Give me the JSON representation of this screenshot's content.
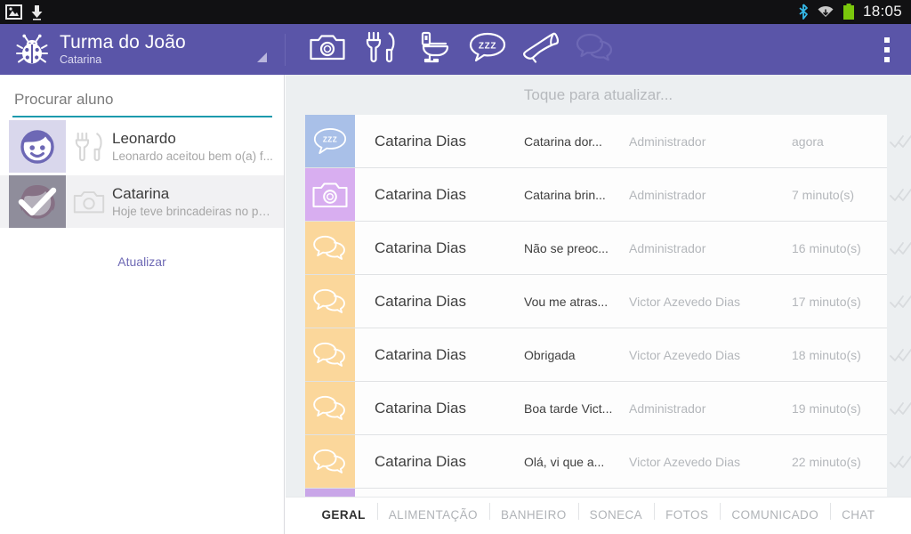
{
  "statusbar": {
    "time": "18:05",
    "icons": [
      "image-icon",
      "download-icon",
      "bluetooth-icon",
      "wifi-icon",
      "battery-icon"
    ],
    "battery_color": "#7ac70c"
  },
  "appbar": {
    "logo_icon": "ladybug-icon",
    "title": "Turma do João",
    "subtitle": "Catarina",
    "accent_color": "#5a55a8",
    "actions": [
      {
        "name": "camera",
        "icon": "camera-icon",
        "enabled": true
      },
      {
        "name": "meal",
        "icon": "cutlery-icon",
        "enabled": true
      },
      {
        "name": "bathroom",
        "icon": "toilet-icon",
        "enabled": true
      },
      {
        "name": "nap",
        "icon": "zzz-bubble-icon",
        "enabled": true
      },
      {
        "name": "announcement",
        "icon": "megaphone-icon",
        "enabled": true
      },
      {
        "name": "chat",
        "icon": "chat-bubble-icon",
        "enabled": false
      }
    ],
    "overflow_icon": "overflow-menu-icon"
  },
  "sidebar": {
    "search": {
      "placeholder": "Procurar aluno",
      "value": "",
      "underline_color": "#1c9aad"
    },
    "students": [
      {
        "name": "Leonardo",
        "description": "Leonardo aceitou bem o(a) f...",
        "avatar_icon": "boy-face-icon",
        "type_icon": "cutlery-icon",
        "selected": false
      },
      {
        "name": "Catarina",
        "description": "Hoje teve brincadeiras no pa...",
        "avatar_icon": "girl-face-icon",
        "type_icon": "camera-icon",
        "selected": true
      }
    ],
    "refresh_label": "Atualizar"
  },
  "main": {
    "pull_hint": "Toque para atualizar...",
    "columns": [
      "student",
      "message",
      "author",
      "time",
      "status"
    ],
    "rows": [
      {
        "icon": "zzz-bubble-icon",
        "icon_bg": "#a9c0e8",
        "student": "Catarina Dias",
        "message": "Catarina  dor...",
        "author": "Administrador",
        "time": "agora",
        "status_icon": "double-check-icon"
      },
      {
        "icon": "camera-icon",
        "icon_bg": "#d8aef0",
        "student": "Catarina Dias",
        "message": "Catarina brin...",
        "author": "Administrador",
        "time": "7 minuto(s)",
        "status_icon": "double-check-icon"
      },
      {
        "icon": "chat-bubble-icon",
        "icon_bg": "#fbd79b",
        "student": "Catarina Dias",
        "message": "Não se preoc...",
        "author": "Administrador",
        "time": "16 minuto(s)",
        "status_icon": "double-check-icon"
      },
      {
        "icon": "chat-bubble-icon",
        "icon_bg": "#fbd79b",
        "student": "Catarina Dias",
        "message": "Vou me atras...",
        "author": "Victor Azevedo Dias",
        "time": "17 minuto(s)",
        "status_icon": "double-check-icon"
      },
      {
        "icon": "chat-bubble-icon",
        "icon_bg": "#fbd79b",
        "student": "Catarina Dias",
        "message": "Obrigada",
        "author": "Victor Azevedo Dias",
        "time": "18 minuto(s)",
        "status_icon": "double-check-icon"
      },
      {
        "icon": "chat-bubble-icon",
        "icon_bg": "#fbd79b",
        "student": "Catarina Dias",
        "message": "Boa tarde Vict...",
        "author": "Administrador",
        "time": "19 minuto(s)",
        "status_icon": "double-check-icon"
      },
      {
        "icon": "chat-bubble-icon",
        "icon_bg": "#fbd79b",
        "student": "Catarina Dias",
        "message": "Olá, vi que a...",
        "author": "Victor Azevedo Dias",
        "time": "22 minuto(s)",
        "status_icon": "double-check-icon"
      },
      {
        "icon": "camera-icon",
        "icon_bg": "#c9a6e8",
        "student": "",
        "message": "",
        "author": "",
        "time": "",
        "status_icon": ""
      }
    ]
  },
  "tabs": [
    {
      "label": "GERAL",
      "active": true
    },
    {
      "label": "ALIMENTAÇÃO",
      "active": false
    },
    {
      "label": "BANHEIRO",
      "active": false
    },
    {
      "label": "SONECA",
      "active": false
    },
    {
      "label": "FOTOS",
      "active": false
    },
    {
      "label": "COMUNICADO",
      "active": false
    },
    {
      "label": "CHAT",
      "active": false
    }
  ]
}
